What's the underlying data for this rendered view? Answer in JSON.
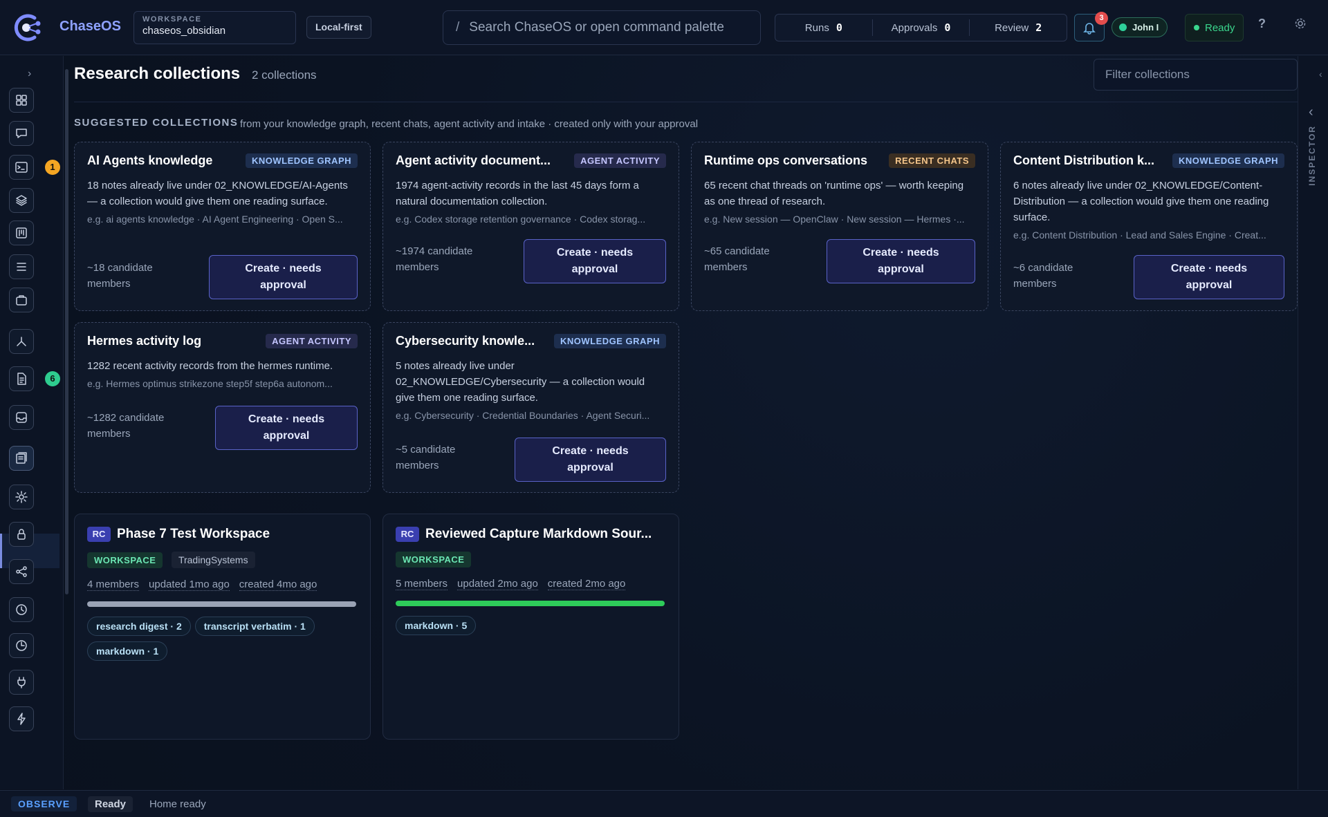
{
  "topbar": {
    "brand": "ChaseOS",
    "workspace_label": "WORKSPACE",
    "workspace_value": "chaseos_obsidian",
    "mode_chip": "Local-first",
    "search_slash": "/",
    "search_placeholder": "Search ChaseOS or open command palette",
    "counters": [
      {
        "label": "Runs",
        "value": "0"
      },
      {
        "label": "Approvals",
        "value": "0"
      },
      {
        "label": "Review",
        "value": "2"
      }
    ],
    "notifications_count": "3",
    "user_name": "John I",
    "status": "Ready",
    "help": "?"
  },
  "sidebar": {
    "expand": "›",
    "items": [
      {
        "name": "dashboard",
        "icon": "grid-icon"
      },
      {
        "name": "chat",
        "icon": "chat-icon"
      },
      {
        "name": "terminal",
        "icon": "terminal-icon",
        "badge": "1"
      },
      {
        "name": "layers",
        "icon": "layers-icon"
      },
      {
        "name": "board",
        "icon": "kanban-icon"
      },
      {
        "name": "list",
        "icon": "list-icon"
      },
      {
        "name": "bag",
        "icon": "bag-icon"
      },
      {
        "name": "graph",
        "icon": "graph-icon"
      },
      {
        "name": "documents",
        "icon": "document-icon",
        "badge": "6"
      },
      {
        "name": "inbox",
        "icon": "inbox-icon"
      },
      {
        "name": "collections",
        "icon": "collection-icon",
        "active": true
      },
      {
        "name": "settings",
        "icon": "gear-icon"
      },
      {
        "name": "security",
        "icon": "lock-icon"
      },
      {
        "name": "share",
        "icon": "share-icon"
      },
      {
        "name": "history",
        "icon": "history-icon"
      },
      {
        "name": "clock",
        "icon": "clock-icon"
      },
      {
        "name": "plugins",
        "icon": "plug-icon"
      },
      {
        "name": "automation",
        "icon": "bolt-icon"
      }
    ],
    "badge_colors": {
      "1": "#f5a623",
      "6": "#2ecc8f"
    }
  },
  "main": {
    "title": "Research collections",
    "count": "2 collections",
    "filter_placeholder": "Filter collections",
    "suggested_heading": "SUGGESTED COLLECTIONS",
    "suggested_sub": "from your knowledge graph, recent chats, agent activity and intake · created only with your approval",
    "suggestions": [
      {
        "title": "AI Agents knowledge",
        "badge": "KNOWLEDGE GRAPH",
        "desc": "18 notes already live under 02_KNOWLEDGE/AI-Agents — a collection would give them one reading surface.",
        "eg": "e.g. ai agents knowledge · AI Agent Engineering · Open S...",
        "candidates": "~18 candidate members",
        "button": "Create · needs approval"
      },
      {
        "title": "Agent activity document...",
        "badge": "AGENT ACTIVITY",
        "desc": "1974 agent-activity records in the last 45 days form a natural documentation collection.",
        "eg": "e.g. Codex storage retention governance · Codex storag...",
        "candidates": "~1974 candidate members",
        "button": "Create · needs approval"
      },
      {
        "title": "Runtime ops conversations",
        "badge": "RECENT CHATS",
        "desc": "65 recent chat threads on 'runtime ops' — worth keeping as one thread of research.",
        "eg": "e.g. New session — OpenClaw · New session — Hermes ·...",
        "candidates": "~65 candidate members",
        "button": "Create · needs approval"
      },
      {
        "title": "Content Distribution k...",
        "badge": "KNOWLEDGE GRAPH",
        "desc": "6 notes already live under 02_KNOWLEDGE/Content-Distribution — a collection would give them one reading surface.",
        "eg": "e.g. Content Distribution · Lead and Sales Engine · Creat...",
        "candidates": "~6 candidate members",
        "button": "Create · needs approval"
      },
      {
        "title": "Hermes activity log",
        "badge": "AGENT ACTIVITY",
        "desc": "1282 recent activity records from the hermes runtime.",
        "eg": "e.g. Hermes optimus strikezone step5f step6a autonom...",
        "candidates": "~1282 candidate members",
        "button": "Create · needs approval"
      },
      {
        "title": "Cybersecurity knowle...",
        "badge": "KNOWLEDGE GRAPH",
        "desc": "5 notes already live under 02_KNOWLEDGE/Cybersecurity — a collection would give them one reading surface.",
        "eg": "e.g. Cybersecurity · Credential Boundaries · Agent Securi...",
        "candidates": "~5 candidate members",
        "button": "Create · needs approval"
      }
    ],
    "collections": [
      {
        "abbr": "RC",
        "title": "Phase 7 Test Workspace",
        "tags": [
          "WORKSPACE",
          "TradingSystems"
        ],
        "members": "4 members",
        "updated": "updated 1mo ago",
        "created": "created 4mo ago",
        "progress_color": "#9aa3b5",
        "pills": [
          "research digest · 2",
          "transcript verbatim · 1",
          "markdown · 1"
        ]
      },
      {
        "abbr": "RC",
        "title": "Reviewed Capture Markdown Sour...",
        "tags": [
          "WORKSPACE"
        ],
        "members": "5 members",
        "updated": "updated 2mo ago",
        "created": "created 2mo ago",
        "progress_color": "#2ecc5a",
        "pills": [
          "markdown · 5"
        ]
      }
    ]
  },
  "inspector": {
    "label": "INSPECTOR",
    "collapse": "‹"
  },
  "statusbar": {
    "mode": "OBSERVE",
    "state": "Ready",
    "message": "Home ready"
  }
}
